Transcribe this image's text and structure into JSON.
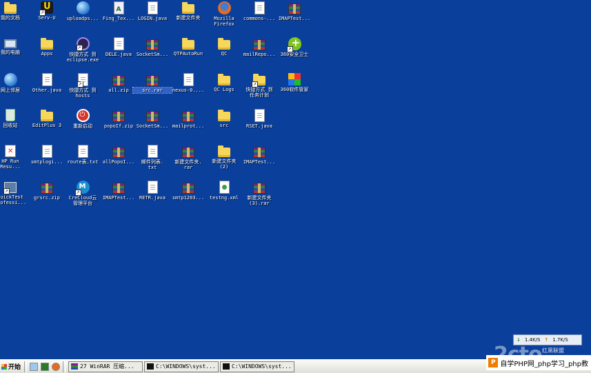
{
  "desktop": {
    "icons": [
      {
        "label": "我的文档",
        "glyph": "folder-docs",
        "cls": "g-folder"
      },
      {
        "label": "我的电脑",
        "glyph": "computer",
        "cls": "g-computer"
      },
      {
        "label": "网上邻居",
        "glyph": "network",
        "cls": "g-globe"
      },
      {
        "label": "回收站",
        "glyph": "recycle-bin",
        "cls": "g-recycle"
      },
      {
        "label": "HP Run\nResu...",
        "glyph": "hp-run-results",
        "cls": "g-run"
      },
      {
        "label": "QuickTest\nProfessi...",
        "glyph": "quicktest",
        "cls": "g-qtp",
        "shortcut": true
      },
      {
        "label": "Serv-U",
        "glyph": "serv-u",
        "cls": "g-serv",
        "shortcut": true
      },
      {
        "label": "Apps",
        "glyph": "folder",
        "cls": "g-folder"
      },
      {
        "label": "Other.java",
        "glyph": "java-file",
        "cls": "g-doc"
      },
      {
        "label": "EditPlus 3",
        "glyph": "folder",
        "cls": "g-folder"
      },
      {
        "label": "smtplogi...",
        "glyph": "text-file",
        "cls": "g-doc"
      },
      {
        "label": "grsrc.zip",
        "glyph": "rar-archive",
        "cls": "g-rar"
      },
      {
        "label": "uploadps...",
        "glyph": "ie-globe",
        "cls": "g-globe"
      },
      {
        "label": "快捷方式 到\neclipse.exe",
        "glyph": "eclipse",
        "cls": "g-eclipse",
        "shortcut": true
      },
      {
        "label": "快捷方式 到\nhosts",
        "glyph": "text-file",
        "cls": "g-doc",
        "shortcut": true
      },
      {
        "label": "重新启动",
        "glyph": "power",
        "cls": "g-power"
      },
      {
        "label": "route表.txt",
        "glyph": "text-file",
        "cls": "g-doc"
      },
      {
        "label": "CreCloud云\n管理平台",
        "glyph": "crecloud",
        "cls": "g-cloud",
        "shortcut": true
      },
      {
        "label": "Fing_Tex...",
        "glyph": "text-file",
        "cls": "g-text"
      },
      {
        "label": "DELE.java",
        "glyph": "java-file",
        "cls": "g-doc"
      },
      {
        "label": "all.zip",
        "glyph": "rar-archive",
        "cls": "g-rar"
      },
      {
        "label": "popoIf.zip",
        "glyph": "rar-archive",
        "cls": "g-rar"
      },
      {
        "label": "allPopoI...",
        "glyph": "rar-archive",
        "cls": "g-rar"
      },
      {
        "label": "IMAPTest...",
        "glyph": "rar-archive",
        "cls": "g-rar"
      },
      {
        "label": "LOGIN.java",
        "glyph": "java-file",
        "cls": "g-doc"
      },
      {
        "label": "SocketSm...",
        "glyph": "rar-archive",
        "cls": "g-rar"
      },
      {
        "label": "src.rar",
        "glyph": "rar-archive",
        "cls": "g-rar",
        "selected": true
      },
      {
        "label": "SocketSm...",
        "glyph": "rar-archive",
        "cls": "g-rar"
      },
      {
        "label": "邮件列表.\ntxt",
        "glyph": "text-file",
        "cls": "g-doc"
      },
      {
        "label": "RETR.java",
        "glyph": "java-file",
        "cls": "g-doc"
      },
      {
        "label": "新建文件夹",
        "glyph": "folder",
        "cls": "g-folder"
      },
      {
        "label": "QTPAutoRun",
        "glyph": "folder",
        "cls": "g-folder"
      },
      {
        "label": "nexus-0....",
        "glyph": "image-file",
        "cls": "g-doc"
      },
      {
        "label": "mailprot...",
        "glyph": "rar-archive",
        "cls": "g-rar"
      },
      {
        "label": "新建文件夹.\nrar",
        "glyph": "rar-archive",
        "cls": "g-rar"
      },
      {
        "label": "smtp1203...",
        "glyph": "rar-archive",
        "cls": "g-rar"
      },
      {
        "label": "Mozilla\nFirefox",
        "glyph": "firefox",
        "cls": "g-firefox"
      },
      {
        "label": "QC",
        "glyph": "folder",
        "cls": "g-folder"
      },
      {
        "label": "QC Logs",
        "glyph": "folder",
        "cls": "g-folder"
      },
      {
        "label": "src",
        "glyph": "folder",
        "cls": "g-folder"
      },
      {
        "label": "新建文件夹\n(2)",
        "glyph": "folder",
        "cls": "g-folder"
      },
      {
        "label": "testng.xml",
        "glyph": "xml-file",
        "cls": "g-xml"
      },
      {
        "label": "commons-...",
        "glyph": "text-file",
        "cls": "g-doc"
      },
      {
        "label": "mailRepo...",
        "glyph": "rar-archive",
        "cls": "g-rar"
      },
      {
        "label": "快捷方式 到\n任务计划",
        "glyph": "folder",
        "cls": "g-folder",
        "shortcut": true
      },
      {
        "label": "RSET.java",
        "glyph": "java-file",
        "cls": "g-doc"
      },
      {
        "label": "IMAPTest...",
        "glyph": "rar-archive",
        "cls": "g-rar"
      },
      {
        "label": "新建文件夹\n(3).rar",
        "glyph": "rar-archive",
        "cls": "g-rar"
      },
      {
        "label": "IMAPTest...",
        "glyph": "rar-archive",
        "cls": "g-rar"
      },
      {
        "label": "360安全卫士",
        "glyph": "360-shield",
        "cls": "g-shield",
        "shortcut": true
      },
      {
        "label": "360软件管家",
        "glyph": "360-grid",
        "cls": "g-grid"
      }
    ]
  },
  "netmeter": {
    "down": "1.4K/S",
    "up": "1.7K/S"
  },
  "taskbar": {
    "start_label": "开始",
    "tasks": [
      {
        "label": "27 WinRAR 压缩...",
        "icon": "winrar-icon"
      },
      {
        "label": "C:\\WINDOWS\\syst...",
        "icon": "cmd-icon"
      },
      {
        "label": "C:\\WINDOWS\\syst...",
        "icon": "cmd-icon"
      }
    ]
  },
  "watermark": {
    "text": "自学PHP网_php学习_php教",
    "logo": "P"
  },
  "brand": {
    "text": "2cto",
    "sub": "红黑联盟"
  }
}
